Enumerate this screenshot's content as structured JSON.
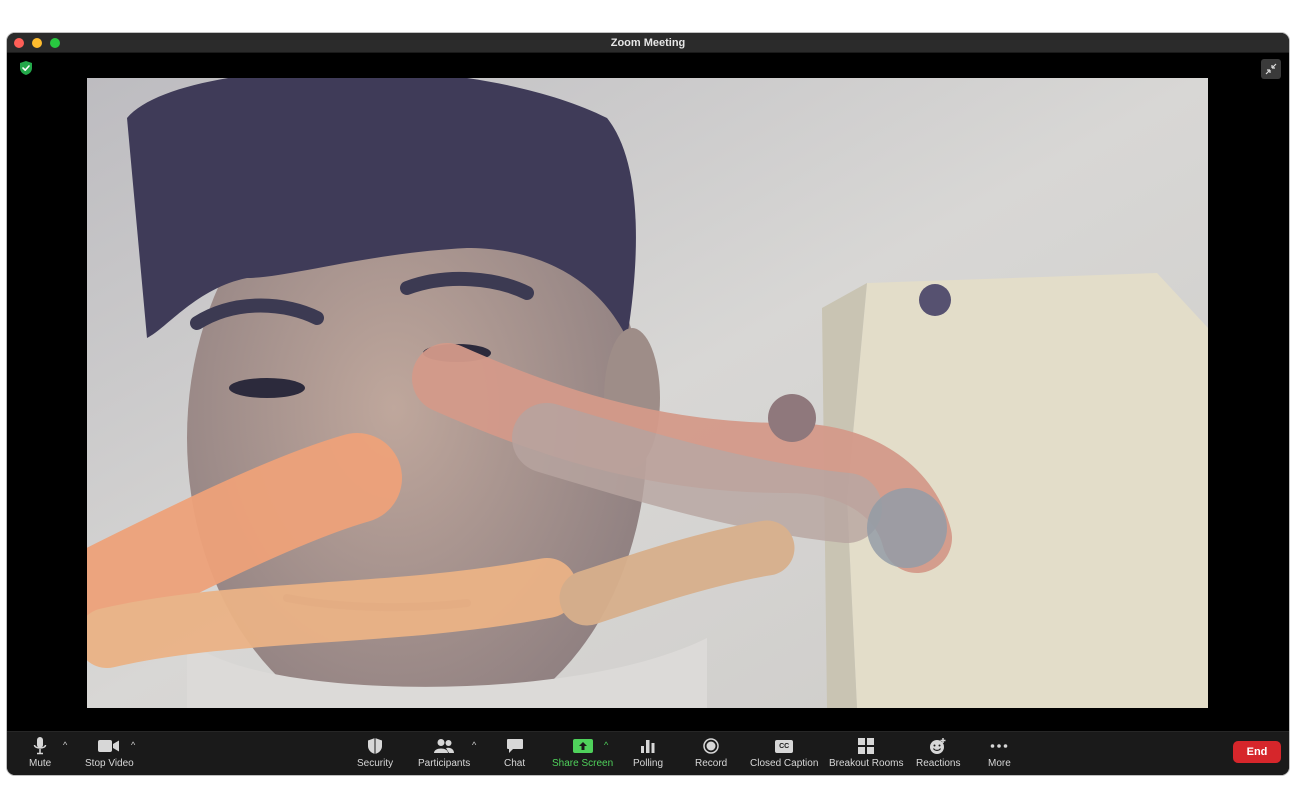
{
  "window": {
    "title": "Zoom Meeting"
  },
  "toolbar": {
    "mute": "Mute",
    "stop_video": "Stop Video",
    "security": "Security",
    "participants": "Participants",
    "chat": "Chat",
    "share_screen": "Share Screen",
    "polling": "Polling",
    "record": "Record",
    "closed_caption": "Closed Caption",
    "closed_caption_icon_text": "CC",
    "breakout_rooms": "Breakout Rooms",
    "reactions": "Reactions",
    "more": "More",
    "end": "End"
  },
  "colors": {
    "end_button": "#d6262b",
    "share_screen_green": "#4fd15b",
    "titlebar": "#2b2b2b",
    "toolbar": "#1a1a1a"
  },
  "icons": {
    "security_shield": "shield-check-icon",
    "exit_fullscreen": "exit-fullscreen-icon"
  }
}
